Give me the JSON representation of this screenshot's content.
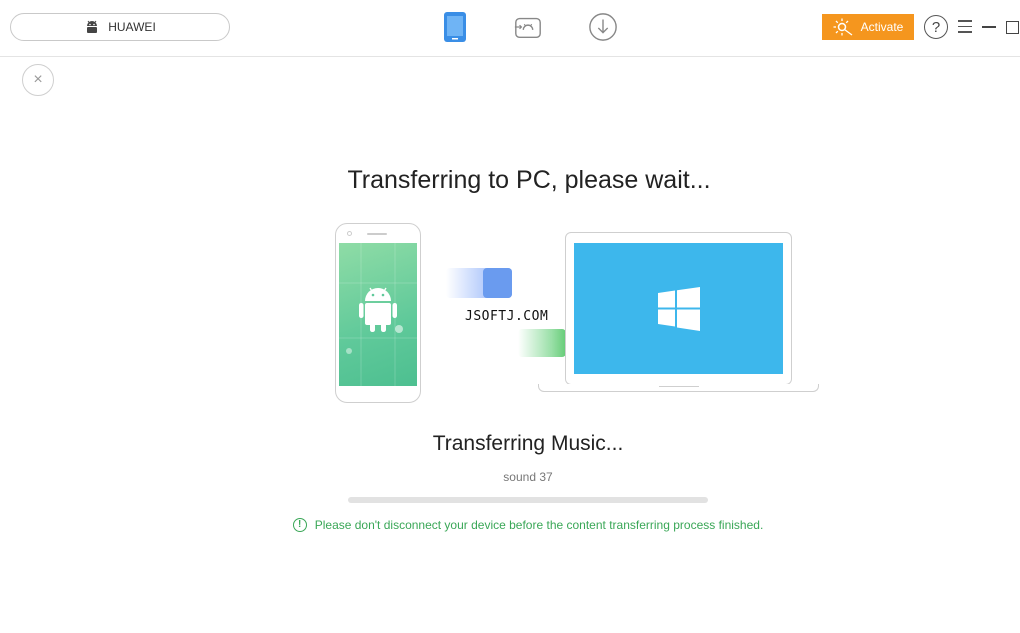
{
  "header": {
    "device_name": "HUAWEI",
    "activate_label": "Activate",
    "help_label": "?",
    "icons": [
      "android-icon",
      "phone-manager-icon",
      "android-mover-icon",
      "download-icon",
      "sun-key-icon",
      "help-icon",
      "menu-icon",
      "minimize-icon",
      "maximize-icon"
    ]
  },
  "close_label": "×",
  "main": {
    "title": "Transferring to PC, please wait...",
    "watermark": "JSOFTJ.COM",
    "status_title": "Transferring Music...",
    "current_item": "sound 37",
    "progress": 0,
    "warning": "Please don't disconnect your device before the content transferring process finished.",
    "warning_icon_glyph": "!"
  },
  "colors": {
    "accent_orange": "#f5961e",
    "phone_blue": "#3a8ee6",
    "screen_green": "#5fc99a",
    "screen_blue": "#3db7ec",
    "warning_green": "#3aa757"
  }
}
